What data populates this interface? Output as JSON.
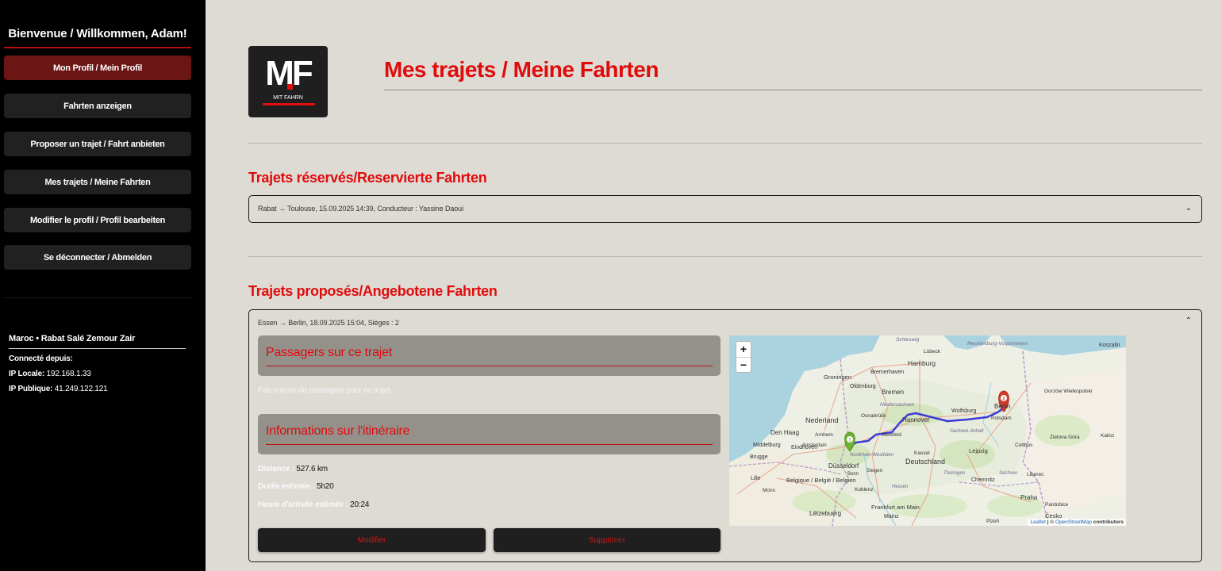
{
  "sidebar": {
    "welcome": "Bienvenue / Willkommen, Adam!",
    "nav": [
      {
        "label": "Mon Profil / Mein Profil",
        "active": true
      },
      {
        "label": "Fahrten anzeigen"
      },
      {
        "label": "Proposer un trajet / Fahrt anbieten"
      },
      {
        "label": "Mes trajets / Meine Fahrten"
      },
      {
        "label": "Modifier le profil / Profil bearbeiten"
      },
      {
        "label": "Se déconnecter / Abmelden"
      }
    ],
    "location": "Maroc • Rabat Salé Zemour Zair",
    "connected_label": "Connecté depuis:",
    "ip_local_label": "IP Locale:",
    "ip_local": "192.168.1.33",
    "ip_public_label": "IP Publique:",
    "ip_public": "41.249.122.121"
  },
  "logo": {
    "letters": "MF",
    "subtitle": "MIT FAHRN"
  },
  "page": {
    "title": "Mes trajets / Meine Fahrten"
  },
  "reserved": {
    "title": "Trajets réservés/Reservierte Fahrten",
    "items": [
      "Rabat → Toulouse, 15.09.2025 14:39, Conducteur : Yassine Daoui"
    ]
  },
  "proposed": {
    "title": "Trajets proposés/Angebotene Fahrten",
    "items": [
      {
        "header": "Essen → Berlin, 18.09.2025 15:04, Sièges : 2",
        "passengers_title": "Passagers sur ce trajet",
        "passengers_empty": "Pas encore de passagers pour ce trajet.",
        "route_title": "Informations sur l'itinéraire",
        "distance_label": "Distance :",
        "distance": "527.6 km",
        "duration_label": "Durée estimée :",
        "duration": "5h20",
        "arrival_label": "Heure d'arrivée estimée :",
        "arrival": "20:24",
        "edit_label": "Modifier",
        "delete_label": "Supprimer"
      }
    ]
  },
  "map": {
    "zoom_in": "+",
    "zoom_out": "−",
    "attribution_leaflet": "Leaflet",
    "attribution_rest": " | © ",
    "attribution_osm": "OpenStreetMap",
    "attribution_tail": " contributors",
    "marker_start": "1",
    "marker_end": "2",
    "places": [
      {
        "name": "Schleswig"
      },
      {
        "name": "Lübeck"
      },
      {
        "name": "Mecklenburg-Vorpommern"
      },
      {
        "name": "Koszalin"
      },
      {
        "name": "Hamburg"
      },
      {
        "name": "Bremerhaven"
      },
      {
        "name": "Groningen"
      },
      {
        "name": "Oldenburg"
      },
      {
        "name": "Bremen"
      },
      {
        "name": "Niedersachsen"
      },
      {
        "name": "Osnabrück"
      },
      {
        "name": "Hannover"
      },
      {
        "name": "Wolfsburg"
      },
      {
        "name": "Berlin"
      },
      {
        "name": "Potsdam"
      },
      {
        "name": "Gorzów Wielkopolski"
      },
      {
        "name": "Nederland"
      },
      {
        "name": "Den Haag"
      },
      {
        "name": "Arnhem"
      },
      {
        "name": "Bielefeld"
      },
      {
        "name": "Sachsen-Anhalt"
      },
      {
        "name": "Middelburg"
      },
      {
        "name": "Eindhoven"
      },
      {
        "name": "Nordrhein-Westfalen"
      },
      {
        "name": "Deutschland"
      },
      {
        "name": "Leipzig"
      },
      {
        "name": "Cottbus"
      },
      {
        "name": "Zielona Góra"
      },
      {
        "name": "Brugge"
      },
      {
        "name": "Düsseldorf"
      },
      {
        "name": "Kassel"
      },
      {
        "name": "Thüringen"
      },
      {
        "name": "Sachsen"
      },
      {
        "name": "Chemnitz"
      },
      {
        "name": "Liberec"
      },
      {
        "name": "Lille"
      },
      {
        "name": "Belgique / België / Belgien"
      },
      {
        "name": "Siegen"
      },
      {
        "name": "Hessen"
      },
      {
        "name": "Mons"
      },
      {
        "name": "Koblenz"
      },
      {
        "name": "Frankfurt am Main"
      },
      {
        "name": "Praha"
      },
      {
        "name": "Pardubice"
      },
      {
        "name": "Lëtzebuerg"
      },
      {
        "name": "Mainz"
      },
      {
        "name": "Plzeň"
      },
      {
        "name": "Česko"
      },
      {
        "name": "Kalisz"
      },
      {
        "name": "Bonn"
      },
      {
        "name": "Amsterdam"
      }
    ]
  }
}
